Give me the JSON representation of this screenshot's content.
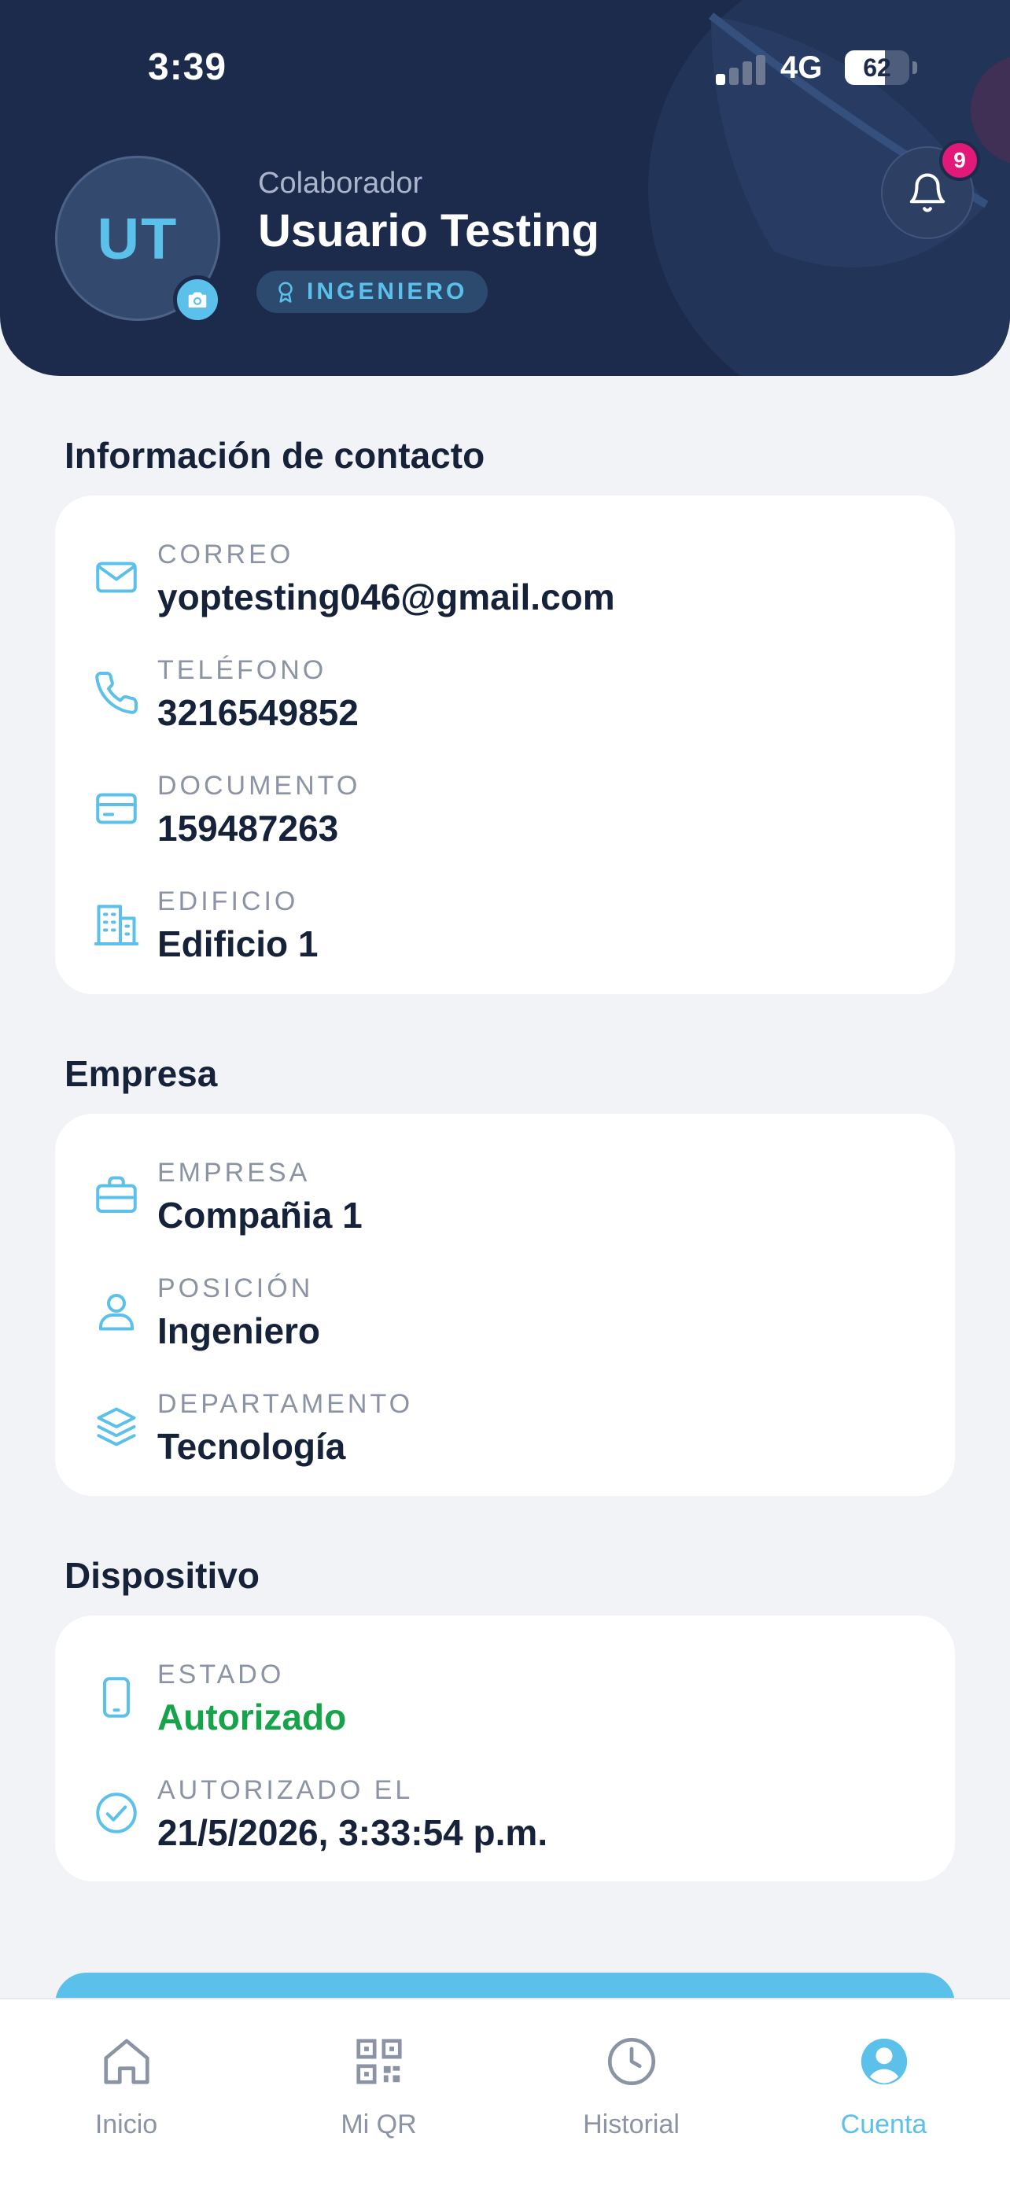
{
  "status_bar": {
    "time": "3:39",
    "network": "4G",
    "battery": "62",
    "battery_level": 0.62
  },
  "profile": {
    "initials": "UT",
    "role_caption": "Colaborador",
    "name": "Usuario Testing",
    "role_badge": "INGENIERO",
    "notification_count": "9"
  },
  "contact": {
    "title": "Información de contacto",
    "rows": [
      {
        "label": "CORREO",
        "value": "yoptesting046@gmail.com",
        "icon": "mail-icon"
      },
      {
        "label": "TELÉFONO",
        "value": "3216549852",
        "icon": "phone-icon"
      },
      {
        "label": "DOCUMENTO",
        "value": "159487263",
        "icon": "id-card-icon"
      },
      {
        "label": "EDIFICIO",
        "value": "Edificio 1",
        "icon": "building-icon"
      }
    ]
  },
  "company": {
    "title": "Empresa",
    "rows": [
      {
        "label": "EMPRESA",
        "value": "Compañia 1",
        "icon": "briefcase-icon"
      },
      {
        "label": "POSICIÓN",
        "value": "Ingeniero",
        "icon": "user-icon"
      },
      {
        "label": "DEPARTAMENTO",
        "value": "Tecnología",
        "icon": "layers-icon"
      }
    ]
  },
  "device": {
    "title": "Dispositivo",
    "rows": [
      {
        "label": "ESTADO",
        "value": "Autorizado",
        "icon": "smartphone-icon"
      },
      {
        "label": "AUTORIZADO EL",
        "value": "21/5/2026, 3:33:54 p.m.",
        "icon": "check-circle-icon"
      }
    ]
  },
  "nav": {
    "items": [
      {
        "label": "Inicio",
        "icon": "home-icon"
      },
      {
        "label": "Mi QR",
        "icon": "qr-code-icon"
      },
      {
        "label": "Historial",
        "icon": "clock-icon"
      },
      {
        "label": "Cuenta",
        "icon": "account-icon"
      }
    ],
    "active": "Cuenta"
  },
  "colors": {
    "header_bg": "#1c2b4b",
    "accent": "#5bc0ea",
    "success": "#16a34a",
    "badge": "#e3197a",
    "page_bg": "#f2f3f6"
  }
}
